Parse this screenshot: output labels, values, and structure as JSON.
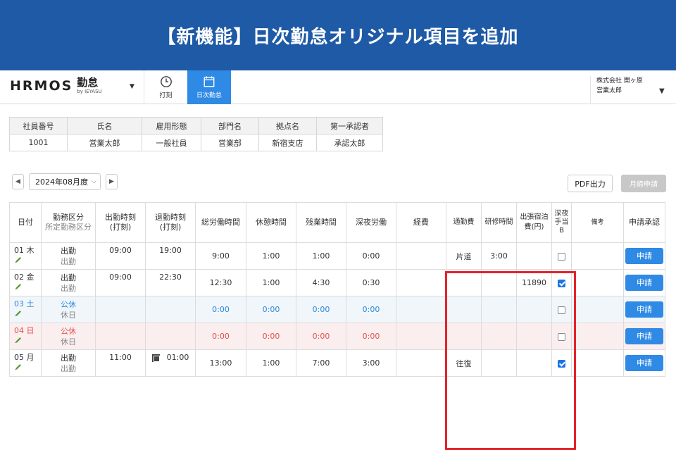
{
  "banner": {
    "title": "【新機能】日次勤怠オリジナル項目を追加"
  },
  "header": {
    "logo_main": "HRMOS",
    "logo_kintai": "勤怠",
    "logo_by": "by IEYASU",
    "tabs": [
      {
        "label": "打刻",
        "icon": "clock-icon",
        "active": false
      },
      {
        "label": "日次勤怠",
        "icon": "calendar-icon",
        "active": true
      }
    ],
    "company": "株式会社 関ヶ原",
    "user": "営業太郎"
  },
  "employee": {
    "headers": [
      "社員番号",
      "氏名",
      "雇用形態",
      "部門名",
      "拠点名",
      "第一承認者"
    ],
    "values": [
      "1001",
      "営業太郎",
      "一般社員",
      "営業部",
      "新宿支店",
      "承認太郎"
    ]
  },
  "month": {
    "selected": "2024年08月度",
    "pdf_label": "PDF出力",
    "close_label": "月締申請"
  },
  "grid": {
    "headers": {
      "date": "日付",
      "kubun1": "勤務区分",
      "kubun2": "所定勤務区分",
      "in1": "出勤時刻",
      "in2": "(打刻)",
      "out1": "退勤時刻",
      "out2": "(打刻)",
      "total": "総労働時間",
      "rest": "休憩時間",
      "over": "残業時間",
      "night": "深夜労働",
      "expense": "経費",
      "commute": "通勤費",
      "training": "研修時間",
      "trip1": "出張宿泊",
      "trip2": "費(円)",
      "late1": "深夜",
      "late2": "手当",
      "late3": "B",
      "note": "備考",
      "approval": "申請承認"
    },
    "apply_label": "申請",
    "rows": [
      {
        "day": "01",
        "dow": "木",
        "kubun": "出勤",
        "shotei": "出勤",
        "in": "09:00",
        "out": "19:00",
        "total": "9:00",
        "rest": "1:00",
        "over": "1:00",
        "night": "0:00",
        "expense": "",
        "commute": "片道",
        "training": "3:00",
        "trip": "",
        "late_b": false,
        "type": "work"
      },
      {
        "day": "02",
        "dow": "金",
        "kubun": "出勤",
        "shotei": "出勤",
        "in": "09:00",
        "out": "22:30",
        "total": "12:30",
        "rest": "1:00",
        "over": "4:30",
        "night": "0:30",
        "expense": "",
        "commute": "",
        "training": "",
        "trip": "11890",
        "late_b": true,
        "type": "work"
      },
      {
        "day": "03",
        "dow": "土",
        "kubun": "公休",
        "shotei": "休日",
        "in": "",
        "out": "",
        "total": "0:00",
        "rest": "0:00",
        "over": "0:00",
        "night": "0:00",
        "expense": "",
        "commute": "",
        "training": "",
        "trip": "",
        "late_b": false,
        "type": "sat"
      },
      {
        "day": "04",
        "dow": "日",
        "kubun": "公休",
        "shotei": "休日",
        "in": "",
        "out": "",
        "total": "0:00",
        "rest": "0:00",
        "over": "0:00",
        "night": "0:00",
        "expense": "",
        "commute": "",
        "training": "",
        "trip": "",
        "late_b": false,
        "type": "sun"
      },
      {
        "day": "05",
        "dow": "月",
        "kubun": "出勤",
        "shotei": "出勤",
        "in": "11:00",
        "out": "01:00",
        "total": "13:00",
        "rest": "1:00",
        "over": "7:00",
        "night": "3:00",
        "expense": "",
        "commute": "往復",
        "training": "",
        "trip": "",
        "late_b": true,
        "type": "work",
        "out_mark": true
      }
    ]
  },
  "colors": {
    "banner": "#1f5aa6",
    "accent": "#2f8ae5",
    "highlight": "#e3232c",
    "saturday": "#2b8ad8",
    "sunday": "#e05050"
  }
}
